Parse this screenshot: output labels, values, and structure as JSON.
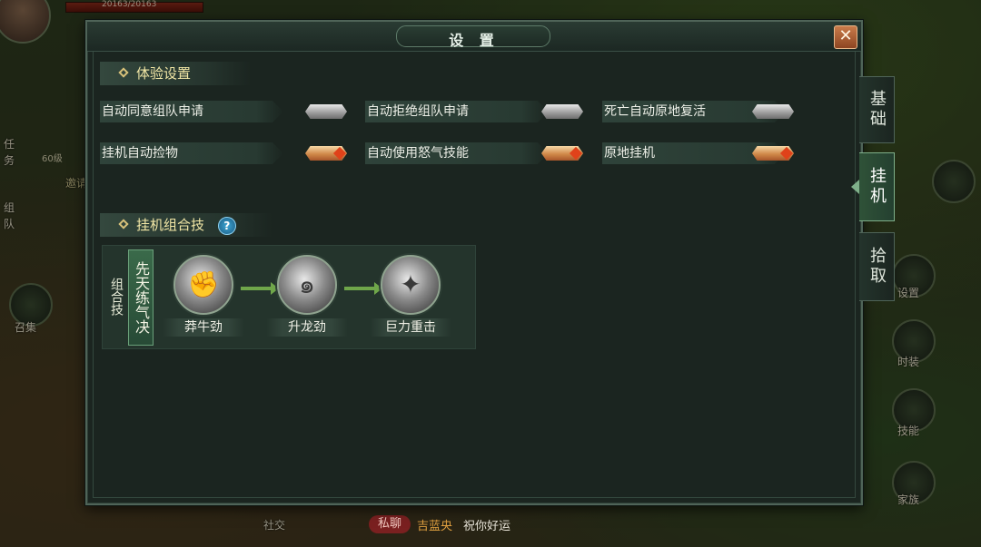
{
  "hud": {
    "hp_text": "20163/20163",
    "level_badge": "60级",
    "side_labels": [
      "任务",
      "组队",
      "召集"
    ],
    "invite_label": "邀请",
    "right_menu": [
      "设置",
      "时装",
      "技能",
      "家族"
    ],
    "social_label": "社交"
  },
  "chat": {
    "channel": "私聊",
    "sender": "吉蓝央",
    "message": "祝你好运"
  },
  "dialog": {
    "title": "设 置",
    "close_icon": "close-icon"
  },
  "experience_section": {
    "title": "体验设置",
    "options": [
      {
        "label": "自动同意组队申请",
        "state": "off"
      },
      {
        "label": "自动拒绝组队申请",
        "state": "off"
      },
      {
        "label": "死亡自动原地复活",
        "state": "off"
      },
      {
        "label": "挂机自动捡物",
        "state": "on"
      },
      {
        "label": "自动使用怒气技能",
        "state": "on"
      },
      {
        "label": "原地挂机",
        "state": "on"
      }
    ]
  },
  "combo_section": {
    "title": "挂机组合技",
    "help_label": "?",
    "tag": "组合技",
    "combo_name": "先天练气决",
    "skills": [
      {
        "label": "莽牛劲",
        "icon": "fist-icon"
      },
      {
        "label": "升龙劲",
        "icon": "dragon-icon"
      },
      {
        "label": "巨力重击",
        "icon": "strike-icon"
      }
    ]
  },
  "tabs": [
    {
      "label": "基础",
      "active": false
    },
    {
      "label": "挂机",
      "active": true
    },
    {
      "label": "拾取",
      "active": false
    }
  ],
  "colors": {
    "panel_bg": "#1b2520",
    "accent_green": "#6fa64a",
    "section_title": "#f2e7a6",
    "toggle_on": "#d18a4a",
    "toggle_off": "#9a9a9a"
  }
}
